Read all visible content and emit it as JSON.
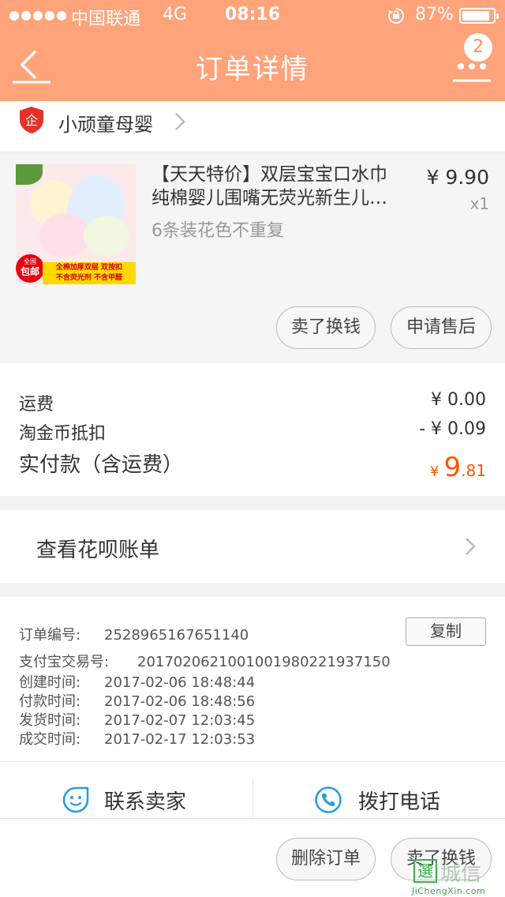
{
  "status_bar": {
    "carrier": "中国联通",
    "network": "4G",
    "time": "08:16",
    "battery": "87%"
  },
  "nav": {
    "title": "订单详情",
    "badge": "2",
    "back_icon": "back-arrow-icon",
    "more_icon": "more-icon",
    "bg_color": "#ffa37b"
  },
  "shop": {
    "name": "小顽童母婴",
    "icon_text": "企",
    "icon_color": "#e6332a"
  },
  "product": {
    "title_line1": "【天天特价】双层宝宝口水巾",
    "title_line2": "纯棉婴儿围嘴无荧光新生儿…",
    "sku": "6条装花色不重复",
    "price": "¥ 9.90",
    "qty": "x1",
    "image_badge_small": "全国",
    "image_badge_big": "包邮",
    "image_banner_line1": "全棉加厚双层 双按扣",
    "image_banner_line2": "不含荧光剂 不含甲醛",
    "buttons": {
      "sell": "卖了换钱",
      "after_sale": "申请售后"
    }
  },
  "costs": {
    "shipping_label": "运费",
    "shipping_value": "¥ 0.00",
    "coin_label": "淘金币抵扣",
    "coin_value": "- ¥ 0.09",
    "paid_label": "实付款（含运费）",
    "paid_symbol": "¥",
    "paid_int": "9",
    "paid_dec": ".81",
    "accent_color": "#ff5500"
  },
  "huabei": {
    "label": "查看花呗账单"
  },
  "order_info": {
    "order_no_label": "订单编号:",
    "order_no": "2528965167651140",
    "copy_label": "复制",
    "alipay_label": "支付宝交易号:",
    "alipay_no": "2017020621001001980221937150",
    "created_label": "创建时间:",
    "created": "2017-02-06 18:48:44",
    "paid_label": "付款时间:",
    "paid": "2017-02-06 18:48:56",
    "shipped_label": "发货时间:",
    "shipped": "2017-02-07 12:03:45",
    "completed_label": "成交时间:",
    "completed": "2017-02-17 12:03:53"
  },
  "contact": {
    "seller_label": "联系卖家",
    "seller_icon": "chat-face-icon",
    "phone_label": "拨打电话",
    "phone_icon": "phone-icon",
    "icon_color": "#2a9ddf"
  },
  "footer": {
    "delete_label": "删除订单",
    "sell_label": "卖了换钱"
  },
  "watermark": {
    "box_char": "選",
    "text": "城信",
    "url": "JiChengXin.com"
  }
}
